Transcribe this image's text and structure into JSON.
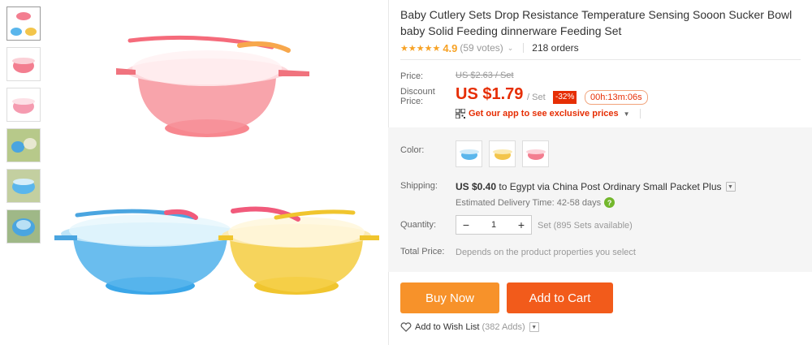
{
  "product": {
    "title": "Baby Cutlery Sets Drop Resistance Temperature Sensing Sooon Sucker Bowl baby Solid Feeding dinnerware Feeding Set"
  },
  "rating": {
    "stars": "★★★★★",
    "score": "4.9",
    "votes": "(59 votes)",
    "orders": "218 orders"
  },
  "price": {
    "label": "Price:",
    "original": "US $2.63 / Set",
    "discount_label_1": "Discount",
    "discount_label_2": "Price:",
    "current": "US $1.79",
    "unit": "/ Set",
    "off": "-32%",
    "timer": "00h:13m:06s"
  },
  "app_promo": {
    "text": "Get our app to see exclusive prices",
    "caret": "▼"
  },
  "color": {
    "label": "Color:",
    "options": [
      "blue",
      "yellow",
      "pink"
    ]
  },
  "shipping": {
    "label": "Shipping:",
    "price": "US $0.40",
    "route": "to Egypt via China Post Ordinary Small Packet Plus",
    "estimate": "Estimated Delivery Time: 42-58 days",
    "help": "?"
  },
  "quantity": {
    "label": "Quantity:",
    "minus": "−",
    "value": "1",
    "plus": "+",
    "available": "Set (895 Sets available)"
  },
  "total": {
    "label": "Total Price:",
    "value": "Depends on the product properties you select"
  },
  "actions": {
    "buy_now": "Buy Now",
    "add_to_cart": "Add to Cart",
    "wish": "Add to Wish List",
    "wish_count": "(382 Adds)"
  },
  "colors": {
    "accent_red": "#e62e04",
    "buy_orange": "#f7922a",
    "cart_orange": "#f25b1b",
    "star": "#f7a225"
  }
}
